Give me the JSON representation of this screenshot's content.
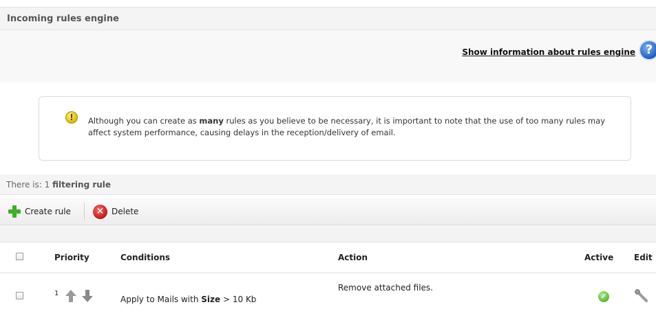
{
  "header": {
    "title": "Incoming rules engine"
  },
  "info": {
    "link_label": "Show information about rules engine",
    "help_icon": "question-circle-icon"
  },
  "notice": {
    "icon": "warning-icon",
    "text_before": "Although you can create as ",
    "text_bold": "many",
    "text_after": " rules as you believe to be necessary, it is important to note that the use of too many rules may affect system performance, causing delays in the reception/delivery of email."
  },
  "summary": {
    "prefix": "There is: ",
    "count": "1",
    "suffix": "filtering rule"
  },
  "toolbar": {
    "create_label": "Create rule",
    "delete_label": "Delete"
  },
  "table": {
    "headers": {
      "priority": "Priority",
      "conditions": "Conditions",
      "action": "Action",
      "active": "Active",
      "edit": "Edit"
    },
    "rows": [
      {
        "priority": "1",
        "condition_prefix": "Apply to Mails with ",
        "condition_field": "Size",
        "condition_rest": " > 10 Kb",
        "action": "Remove attached files.",
        "active": true
      }
    ]
  },
  "colors": {
    "accent_green": "#3fae2a",
    "delete_red": "#c41717",
    "help_blue": "#1f5fbf",
    "warning_yellow": "#d9b400"
  }
}
